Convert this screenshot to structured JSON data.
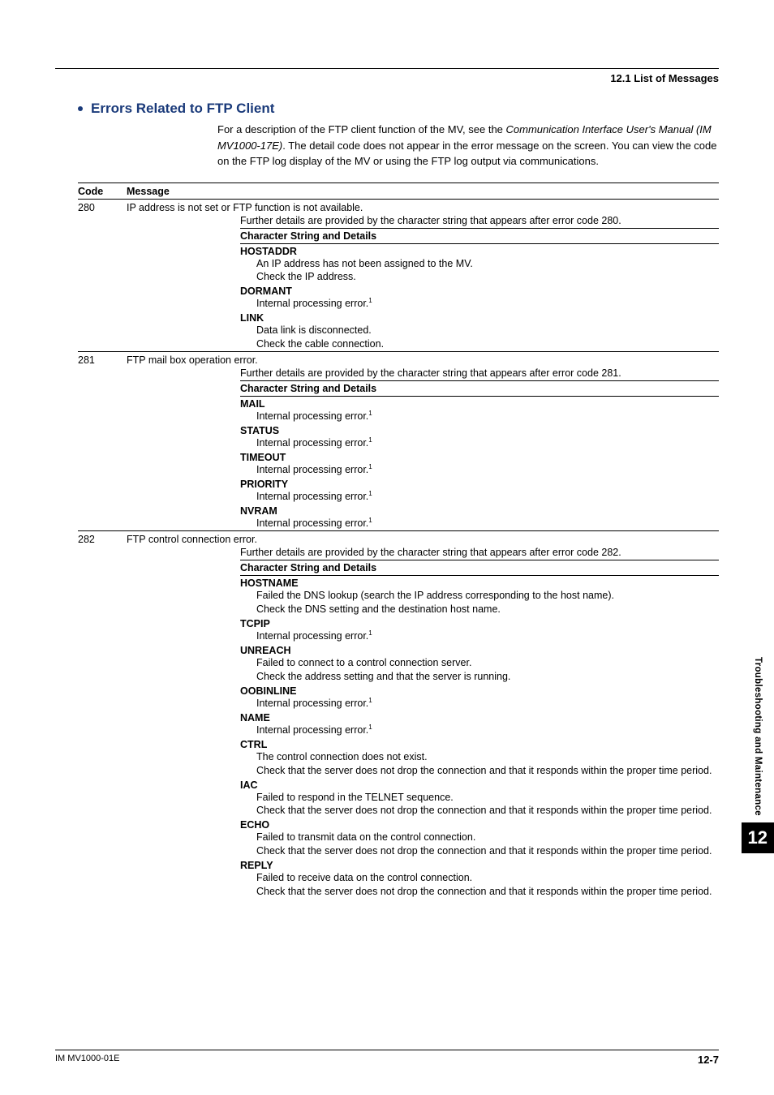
{
  "running_header": "12.1  List of Messages",
  "section_title": "Errors Related to FTP Client",
  "intro_parts": {
    "p1": "For a description of the FTP client function of the MV, see the ",
    "italic": "Communication Interface User's Manual (IM MV1000-17E)",
    "p2": ". The detail code does not appear in the error message on the screen. You can view the code on the FTP log display of the MV or using the FTP log output via communications."
  },
  "table_header": {
    "code": "Code",
    "message": "Message"
  },
  "details_header_label": "Character String and Details",
  "rows": [
    {
      "code": "280",
      "message": "IP address is not set or FTP function is not available.",
      "details_intro": "Further details are provided by the character string that appears after error code 280.",
      "strings": [
        {
          "name": "HOSTADDR",
          "lines": [
            "An IP address has not been assigned to the MV.",
            "Check the IP address."
          ]
        },
        {
          "name": "DORMANT",
          "lines_sup": [
            [
              "Internal processing error.",
              "1"
            ]
          ]
        },
        {
          "name": "LINK",
          "lines": [
            "Data link is disconnected.",
            "Check the cable connection."
          ]
        }
      ]
    },
    {
      "code": "281",
      "message": "FTP mail box operation error.",
      "details_intro": "Further details are provided by the character string that appears after error code 281.",
      "strings": [
        {
          "name": "MAIL",
          "lines_sup": [
            [
              "Internal processing error.",
              "1"
            ]
          ]
        },
        {
          "name": "STATUS",
          "lines_sup": [
            [
              "Internal processing error.",
              "1"
            ]
          ]
        },
        {
          "name": "TIMEOUT",
          "lines_sup": [
            [
              "Internal processing error.",
              "1"
            ]
          ]
        },
        {
          "name": "PRIORITY",
          "lines_sup": [
            [
              "Internal processing error.",
              "1"
            ]
          ]
        },
        {
          "name": "NVRAM",
          "lines_sup": [
            [
              "Internal processing error.",
              "1"
            ]
          ]
        }
      ]
    },
    {
      "code": "282",
      "message": "FTP control connection error.",
      "details_intro": "Further details are provided by the character string that appears after error code 282.",
      "strings": [
        {
          "name": "HOSTNAME",
          "lines": [
            "Failed the DNS lookup (search the IP address corresponding to the host name).",
            "Check the DNS setting and the destination host name."
          ]
        },
        {
          "name": "TCPIP",
          "lines_sup": [
            [
              "Internal processing error.",
              "1"
            ]
          ]
        },
        {
          "name": "UNREACH",
          "lines": [
            "Failed to connect to a control connection server.",
            "Check the address setting and that the server is running."
          ]
        },
        {
          "name": "OOBINLINE",
          "lines_sup": [
            [
              "Internal processing error.",
              "1"
            ]
          ]
        },
        {
          "name": "NAME",
          "lines_sup": [
            [
              "Internal processing error.",
              "1"
            ]
          ]
        },
        {
          "name": "CTRL",
          "lines": [
            "The control connection does not exist.",
            "Check that the server does not drop the connection and that it responds within the proper time period."
          ]
        },
        {
          "name": "IAC",
          "lines": [
            "Failed to respond in the TELNET sequence.",
            "Check that the server does not drop the connection and that it responds within the proper time period."
          ]
        },
        {
          "name": "ECHO",
          "lines": [
            "Failed to transmit data on the control connection.",
            "Check that the server does not drop the connection and that it responds within the proper time period."
          ]
        },
        {
          "name": "REPLY",
          "lines": [
            "Failed to receive data on the control connection.",
            "Check that the server does not drop the connection and that it responds within the proper time period."
          ]
        }
      ]
    }
  ],
  "side_tab": {
    "text": "Troubleshooting and Maintenance",
    "chapter": "12"
  },
  "footer": {
    "left": "IM MV1000-01E",
    "right": "12-7"
  }
}
